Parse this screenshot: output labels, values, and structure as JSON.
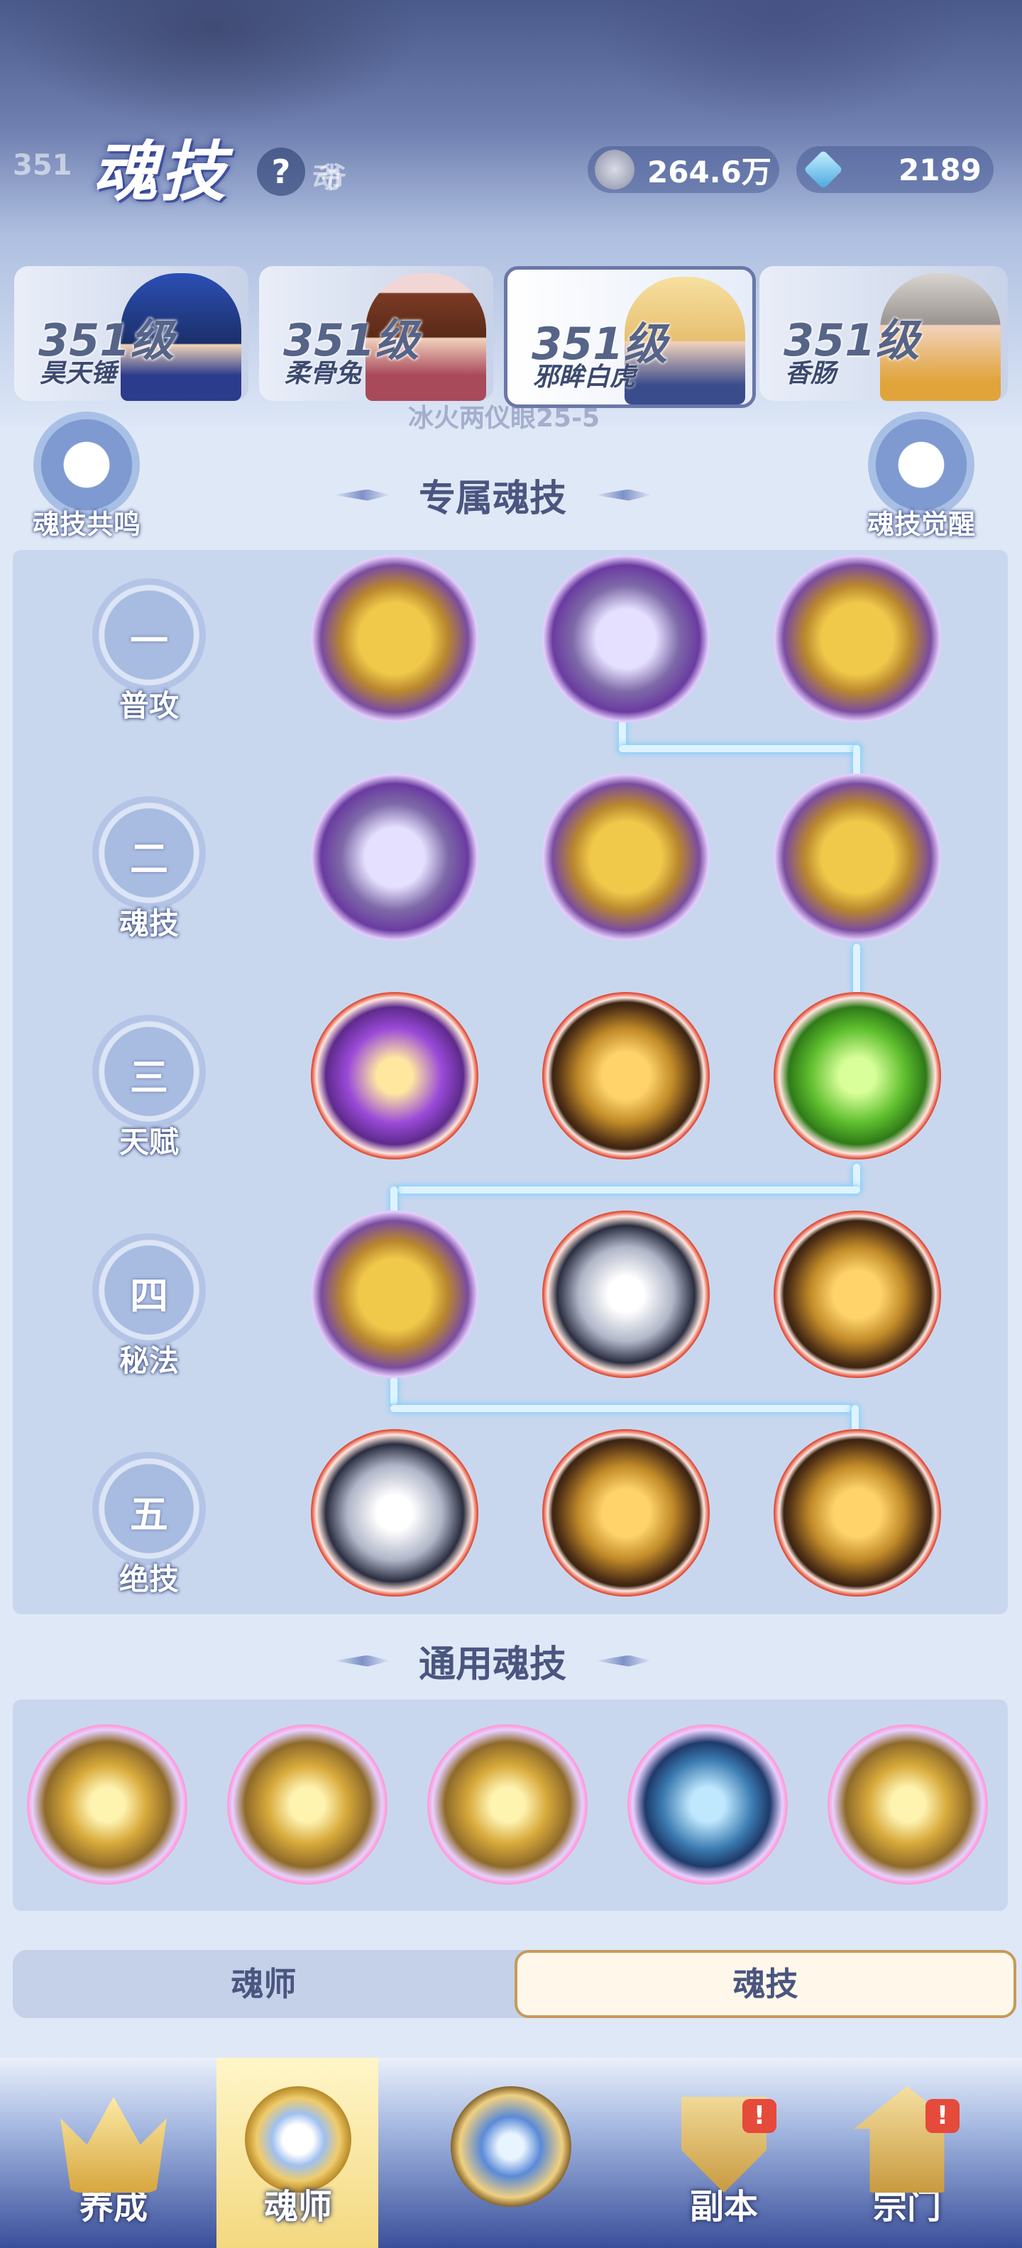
{
  "header": {
    "title": "魂技",
    "help_icon": "question-mark-icon",
    "bg_text_left": "351",
    "bg_text_mid": "动",
    "bg_text_right": "爷",
    "bg_text_sub": "冰火两仪眼25-5"
  },
  "resources": [
    {
      "icon": "coin-icon",
      "value": "264.6万"
    },
    {
      "icon": "diamond-icon",
      "value": "2189"
    }
  ],
  "characters": [
    {
      "level": "351级",
      "name": "昊天锤",
      "selected": false
    },
    {
      "level": "351级",
      "name": "柔骨兔",
      "selected": false
    },
    {
      "level": "351级",
      "name": "邪眸白虎",
      "selected": true
    },
    {
      "level": "351级",
      "name": "香肠",
      "selected": false
    }
  ],
  "side_buttons": {
    "left": "魂技共鸣",
    "right": "魂技觉醒"
  },
  "sections": {
    "exclusive": "专属魂技",
    "general": "通用魂技"
  },
  "rows": [
    {
      "num": "一",
      "label": "普攻"
    },
    {
      "num": "二",
      "label": "魂技"
    },
    {
      "num": "三",
      "label": "天赋"
    },
    {
      "num": "四",
      "label": "秘法"
    },
    {
      "num": "五",
      "label": "绝技"
    }
  ],
  "tabs": {
    "left": "魂师",
    "right": "魂技",
    "active": "魂技"
  },
  "nav": [
    {
      "label": "养成",
      "icon": "crown-icon"
    },
    {
      "label": "魂师",
      "icon": "soul-master-icon",
      "active": true
    },
    {
      "label": "",
      "icon": "center-star-icon"
    },
    {
      "label": "副本",
      "icon": "shield-dungeon-icon",
      "alert": "!"
    },
    {
      "label": "宗门",
      "icon": "pagoda-icon",
      "alert": "!"
    }
  ]
}
